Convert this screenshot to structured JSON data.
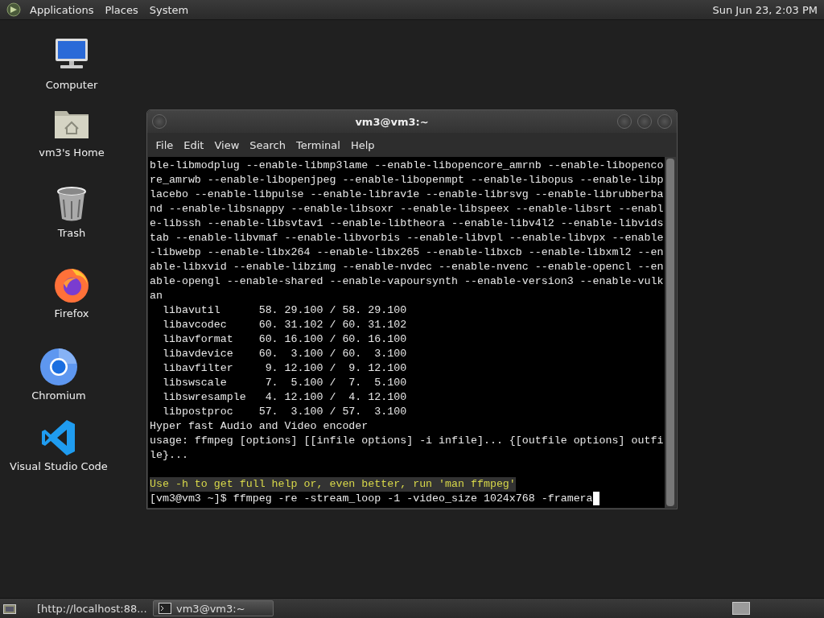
{
  "top_panel": {
    "menus": [
      {
        "label": "Applications",
        "kind": "apps"
      },
      {
        "label": "Places",
        "kind": "plain"
      },
      {
        "label": "System",
        "kind": "plain"
      }
    ],
    "clock": "Sun Jun 23,  2:03 PM"
  },
  "desktop_icons": [
    {
      "label": "Computer",
      "kind": "computer"
    },
    {
      "label": "vm3's Home",
      "kind": "home"
    },
    {
      "label": "Trash",
      "kind": "trash"
    },
    {
      "label": "Firefox",
      "kind": "firefox"
    },
    {
      "label": "Chromium",
      "kind": "chromium"
    },
    {
      "label": "Visual Studio Code",
      "kind": "vscode"
    }
  ],
  "terminal": {
    "title": "vm3@vm3:~",
    "menu": [
      "File",
      "Edit",
      "View",
      "Search",
      "Terminal",
      "Help"
    ],
    "lines": [
      {
        "kind": "out",
        "text": "ble-libmodplug --enable-libmp3lame --enable-libopencore_amrnb --enable-libopenco"
      },
      {
        "kind": "out",
        "text": "re_amrwb --enable-libopenjpeg --enable-libopenmpt --enable-libopus --enable-libp"
      },
      {
        "kind": "out",
        "text": "lacebo --enable-libpulse --enable-librav1e --enable-librsvg --enable-librubberba"
      },
      {
        "kind": "out",
        "text": "nd --enable-libsnappy --enable-libsoxr --enable-libspeex --enable-libsrt --enabl"
      },
      {
        "kind": "out",
        "text": "e-libssh --enable-libsvtav1 --enable-libtheora --enable-libv4l2 --enable-libvids"
      },
      {
        "kind": "out",
        "text": "tab --enable-libvmaf --enable-libvorbis --enable-libvpl --enable-libvpx --enable"
      },
      {
        "kind": "out",
        "text": "-libwebp --enable-libx264 --enable-libx265 --enable-libxcb --enable-libxml2 --en"
      },
      {
        "kind": "out",
        "text": "able-libxvid --enable-libzimg --enable-nvdec --enable-nvenc --enable-opencl --en"
      },
      {
        "kind": "out",
        "text": "able-opengl --enable-shared --enable-vapoursynth --enable-version3 --enable-vulk"
      },
      {
        "kind": "out",
        "text": "an"
      },
      {
        "kind": "out",
        "text": "  libavutil      58. 29.100 / 58. 29.100"
      },
      {
        "kind": "out",
        "text": "  libavcodec     60. 31.102 / 60. 31.102"
      },
      {
        "kind": "out",
        "text": "  libavformat    60. 16.100 / 60. 16.100"
      },
      {
        "kind": "out",
        "text": "  libavdevice    60.  3.100 / 60.  3.100"
      },
      {
        "kind": "out",
        "text": "  libavfilter     9. 12.100 /  9. 12.100"
      },
      {
        "kind": "out",
        "text": "  libswscale      7.  5.100 /  7.  5.100"
      },
      {
        "kind": "out",
        "text": "  libswresample   4. 12.100 /  4. 12.100"
      },
      {
        "kind": "out",
        "text": "  libpostproc    57.  3.100 / 57.  3.100"
      },
      {
        "kind": "out",
        "text": "Hyper fast Audio and Video encoder"
      },
      {
        "kind": "out",
        "text": "usage: ffmpeg [options] [[infile options] -i infile]... {[outfile options] outfi"
      },
      {
        "kind": "out",
        "text": "le}..."
      },
      {
        "kind": "blank"
      },
      {
        "kind": "hint",
        "text": "Use -h to get full help or, even better, run 'man ffmpeg'"
      },
      {
        "kind": "prompt",
        "text": "[vm3@vm3 ~]$ ffmpeg -re -stream_loop -1 -video_size 1024x768 -framera",
        "cursor": true
      }
    ]
  },
  "taskbar": {
    "tasks": [
      {
        "label": "[http://localhost:88...",
        "kind": "browser",
        "selected": false
      },
      {
        "label": "vm3@vm3:~",
        "kind": "terminal",
        "selected": true
      }
    ]
  }
}
